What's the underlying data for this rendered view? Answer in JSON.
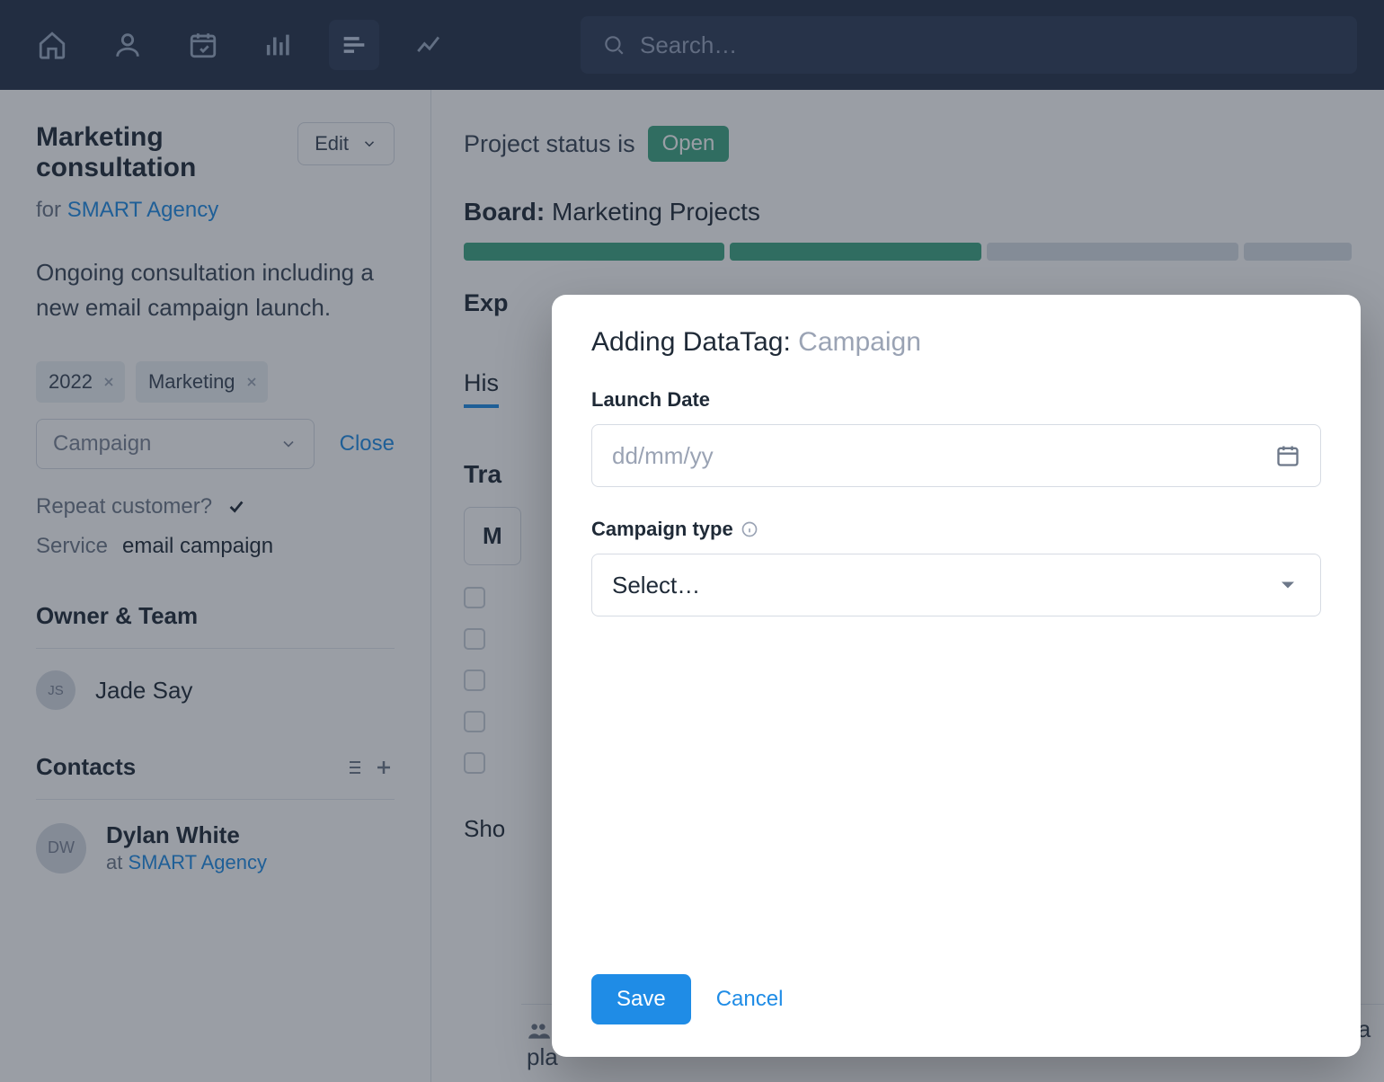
{
  "search": {
    "placeholder": "Search…"
  },
  "sidebar": {
    "title": "Marketing consultation",
    "edit_label": "Edit",
    "for_prefix": "for ",
    "client": "SMART Agency",
    "description": "Ongoing consultation including a new email campaign launch.",
    "tags": [
      "2022",
      "Marketing"
    ],
    "tag_select_value": "Campaign",
    "close_label": "Close",
    "repeat_label": "Repeat customer?",
    "service_label": "Service",
    "service_value": "email campaign",
    "owner_team_heading": "Owner & Team",
    "owner": {
      "initials": "JS",
      "name": "Jade Say"
    },
    "contacts_heading": "Contacts",
    "contact": {
      "initials": "DW",
      "name": "Dylan White",
      "at_prefix": "at ",
      "org": "SMART Agency"
    }
  },
  "content": {
    "status_prefix": "Project status is",
    "status_value": "Open",
    "board_label": "Board:",
    "board_value": "Marketing Projects",
    "expand_label": "Exp",
    "tab_label": "His",
    "tracks_label": "Tra",
    "track_box_label": "M",
    "show_label": "Sho",
    "bottom_note": "First meeting to discuss potential consultancy went well, now need to gather a pla"
  },
  "modal": {
    "title_prefix": "Adding DataTag: ",
    "title_value": "Campaign",
    "field1_label": "Launch Date",
    "field1_placeholder": "dd/mm/yy",
    "field2_label": "Campaign type",
    "field2_placeholder": "Select…",
    "save_label": "Save",
    "cancel_label": "Cancel"
  }
}
